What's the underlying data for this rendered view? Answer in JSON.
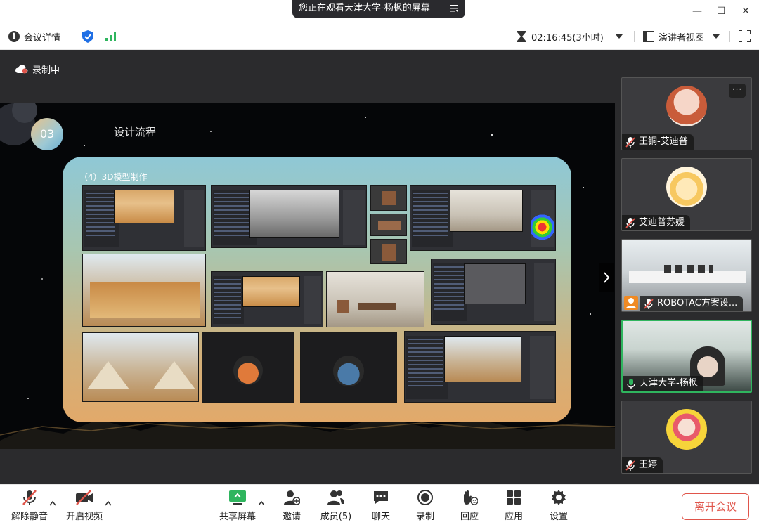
{
  "title_bar": {
    "title": "您正在观看天津大学-杨枫的屏幕",
    "minimize": "—",
    "maximize": "☐",
    "close": "✕"
  },
  "info_bar": {
    "meeting_details": "会议详情",
    "timer": "02:16:45(3小时)",
    "view_mode": "演讲者视图"
  },
  "recording": {
    "label": "录制中"
  },
  "slide": {
    "section_number": "03",
    "section_title": "设计流程",
    "card_title": "（4）3D模型制作"
  },
  "participants": [
    {
      "name": "王铜-艾迪普",
      "muted": true
    },
    {
      "name": "艾迪普苏媛",
      "muted": true
    },
    {
      "name": "ROBOTAC方案设...",
      "muted": true
    },
    {
      "name": "天津大学-杨枫",
      "muted": false,
      "speaking": true
    },
    {
      "name": "王婷",
      "muted": true
    }
  ],
  "participant_more": "···",
  "toolbar": {
    "unmute": "解除静音",
    "start_video": "开启视频",
    "share_screen": "共享屏幕",
    "invite": "邀请",
    "members": "成员(5)",
    "chat": "聊天",
    "record": "录制",
    "reactions": "回应",
    "apps": "应用",
    "settings": "设置",
    "leave": "离开会议"
  },
  "colors": {
    "accent_green": "#2fb55e",
    "leave_red": "#e0554b",
    "shield_blue": "#1f6fe5",
    "signal_green": "#2fb55e",
    "mute_red": "#e0554b"
  }
}
